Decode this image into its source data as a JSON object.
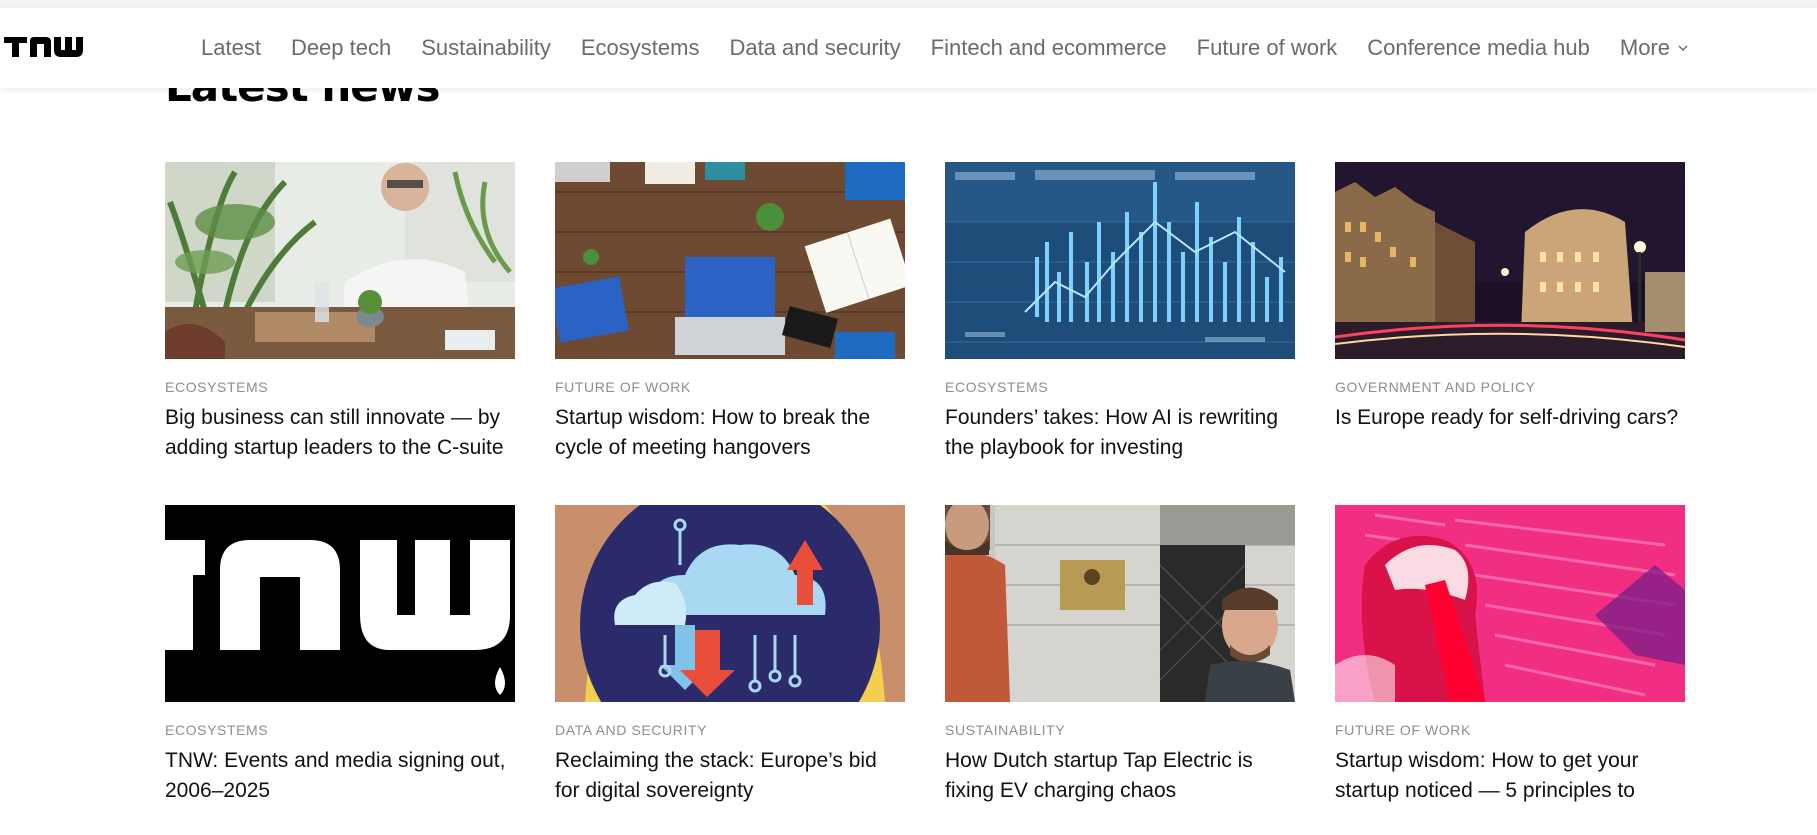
{
  "brand": {
    "logo_text": "TNW"
  },
  "nav": {
    "items": [
      {
        "label": "Latest"
      },
      {
        "label": "Deep tech"
      },
      {
        "label": "Sustainability"
      },
      {
        "label": "Ecosystems"
      },
      {
        "label": "Data and security"
      },
      {
        "label": "Fintech and ecommerce"
      },
      {
        "label": "Future of work"
      },
      {
        "label": "Conference media hub"
      },
      {
        "label": "More",
        "icon": "chevron-down-icon"
      }
    ]
  },
  "section": {
    "title": "Latest news"
  },
  "articles": [
    {
      "category": "ECOSYSTEMS",
      "title": "Big business can still innovate — by adding startup leaders to the C-suite"
    },
    {
      "category": "FUTURE OF WORK",
      "title": "Startup wisdom: How to break the cycle of meeting hangovers"
    },
    {
      "category": "ECOSYSTEMS",
      "title": "Founders’ takes: How AI is rewriting the playbook for investing"
    },
    {
      "category": "GOVERNMENT AND POLICY",
      "title": "Is Europe ready for self-driving cars?"
    },
    {
      "category": "ECOSYSTEMS",
      "title": "TNW: Events and media signing out, 2006–2025"
    },
    {
      "category": "DATA AND SECURITY",
      "title": "Reclaiming the stack: Europe’s bid for digital sovereignty"
    },
    {
      "category": "SUSTAINABILITY",
      "title": "How Dutch startup Tap Electric is fixing EV charging chaos"
    },
    {
      "category": "FUTURE OF WORK",
      "title": "Startup wisdom: How to get your startup noticed — 5 principles to"
    }
  ],
  "colors": {
    "nav_text": "#6b6b6b",
    "category_text": "#8e8e8e",
    "headline_text": "#111111"
  }
}
